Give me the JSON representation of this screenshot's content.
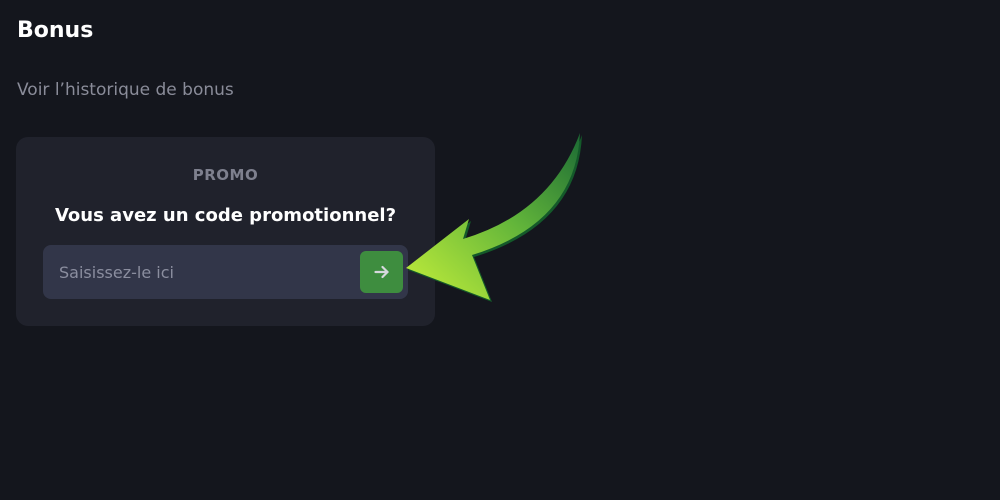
{
  "header": {
    "title": "Bonus"
  },
  "history_link": {
    "label": "Voir l’historique de bonus"
  },
  "promo": {
    "label": "PROMO",
    "question": "Vous avez un code promotionnel?",
    "input": {
      "value": "",
      "placeholder": "Saisissez-le ici"
    },
    "submit_icon": "arrow-right-icon"
  },
  "colors": {
    "background": "#14161d",
    "card": "#20222c",
    "input": "#323649",
    "submit": "#3e8d3f",
    "arrow_light": "#c6f03a",
    "arrow_dark": "#1c6b34"
  }
}
